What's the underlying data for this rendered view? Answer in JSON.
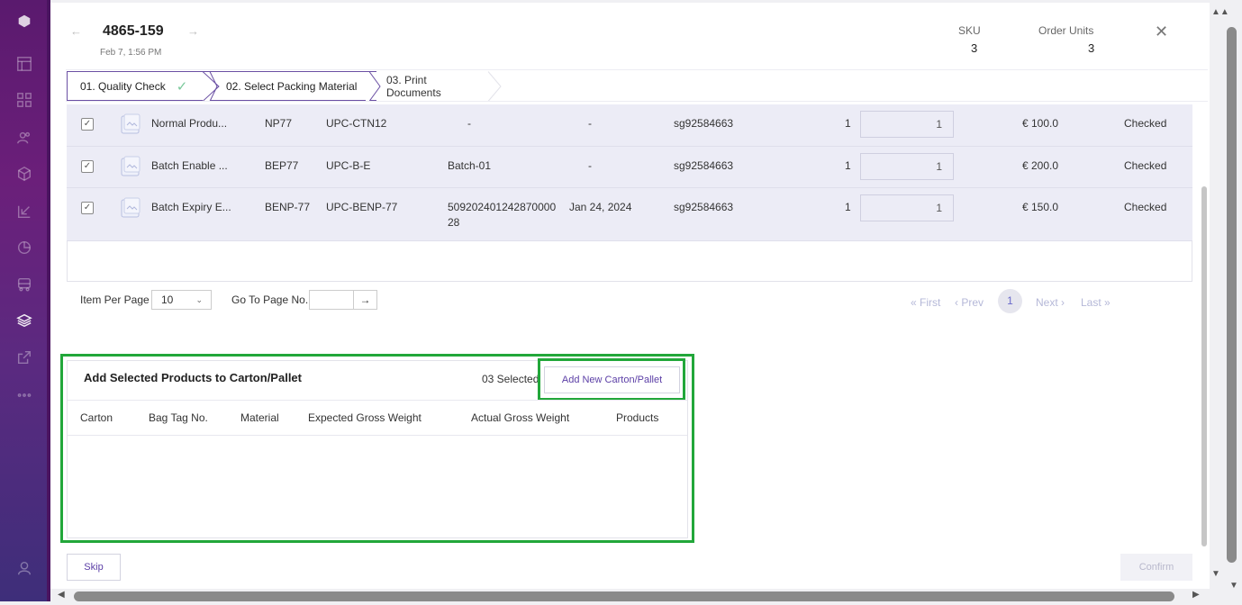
{
  "header": {
    "order_id": "4865-159",
    "date": "Feb 7, 1:56 PM",
    "sku_label": "SKU",
    "sku_value": "3",
    "units_label": "Order Units",
    "units_value": "3",
    "prev_arrow": "←",
    "next_arrow": "→",
    "close": "✕"
  },
  "steps": [
    {
      "label": "01. Quality Check",
      "status": "done"
    },
    {
      "label": "02. Select Packing Material",
      "status": "active"
    },
    {
      "label": "03. Print Documents",
      "status": "pending"
    }
  ],
  "products": [
    {
      "name": "Normal Produ...",
      "sku": "NP77",
      "barcode": "UPC-CTN12",
      "batch": "-",
      "expiry": "-",
      "serial": "sg92584663",
      "qty": "1",
      "pack_qty": "1",
      "price": "€ 100.0",
      "status": "Checked"
    },
    {
      "name": "Batch Enable ...",
      "sku": "BEP77",
      "barcode": "UPC-B-E",
      "batch": "Batch-01",
      "expiry": "-",
      "serial": "sg92584663",
      "qty": "1",
      "pack_qty": "1",
      "price": "€ 200.0",
      "status": "Checked"
    },
    {
      "name": "Batch Expiry E...",
      "sku": "BENP-77",
      "barcode": "UPC-BENP-77",
      "batch": "509202401242870000",
      "batch2": "28",
      "expiry": "Jan 24, 2024",
      "serial": "sg92584663",
      "qty": "1",
      "pack_qty": "1",
      "price": "€ 150.0",
      "status": "Checked"
    }
  ],
  "pagination": {
    "items_per_page_label": "Item Per Page",
    "items_per_page_value": "10",
    "goto_label": "Go To Page No.",
    "goto_btn": "→",
    "first": "« First",
    "prev": "‹ Prev",
    "current": "1",
    "next": "Next ›",
    "last": "Last »"
  },
  "carton": {
    "title": "Add Selected Products to Carton/Pallet",
    "selected": "03 Selected",
    "add_button": "Add New Carton/Pallet",
    "columns": [
      "Carton",
      "Bag Tag No.",
      "Material",
      "Expected Gross Weight",
      "Actual Gross Weight",
      "Products"
    ]
  },
  "footer": {
    "skip": "Skip",
    "confirm": "Confirm"
  },
  "colors": {
    "accent": "#5b3ea6",
    "highlight": "#22a73a",
    "row_bg": "#ececf6"
  }
}
